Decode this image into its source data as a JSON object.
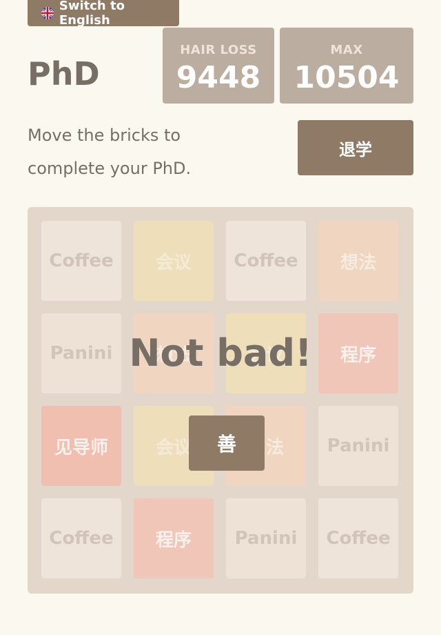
{
  "language_button": {
    "label": "Switch to English",
    "icon": "uk-flag-icon"
  },
  "header": {
    "title": "PhD"
  },
  "scores": {
    "hair_loss": {
      "label": "HAIR LOSS",
      "value": "9448"
    },
    "max": {
      "label": "MAX",
      "value": "10504"
    }
  },
  "intro": {
    "line1": "Move the bricks to",
    "line2": "complete your PhD."
  },
  "quit_button": {
    "label": "退学"
  },
  "board": {
    "rows": [
      [
        {
          "text": "Coffee",
          "kind": "coffee"
        },
        {
          "text": "会议",
          "kind": "meeting"
        },
        {
          "text": "Coffee",
          "kind": "coffee"
        },
        {
          "text": "想法",
          "kind": "idea"
        }
      ],
      [
        {
          "text": "Panini",
          "kind": "panini"
        },
        {
          "text": "想法",
          "kind": "idea"
        },
        {
          "text": "会议",
          "kind": "meeting"
        },
        {
          "text": "程序",
          "kind": "program"
        }
      ],
      [
        {
          "text": "见导师",
          "kind": "mentor"
        },
        {
          "text": "会议",
          "kind": "meeting"
        },
        {
          "text": "想法",
          "kind": "idea"
        },
        {
          "text": "Panini",
          "kind": "panini"
        }
      ],
      [
        {
          "text": "Coffee",
          "kind": "coffee"
        },
        {
          "text": "程序",
          "kind": "program"
        },
        {
          "text": "Panini",
          "kind": "panini"
        },
        {
          "text": "Coffee",
          "kind": "coffee"
        }
      ]
    ]
  },
  "overlay": {
    "message": "Not bad!",
    "retry_label": "善"
  },
  "colors": {
    "accent": "#8f7a66",
    "background": "#fbf8ef",
    "board": "#d9c9bd"
  }
}
